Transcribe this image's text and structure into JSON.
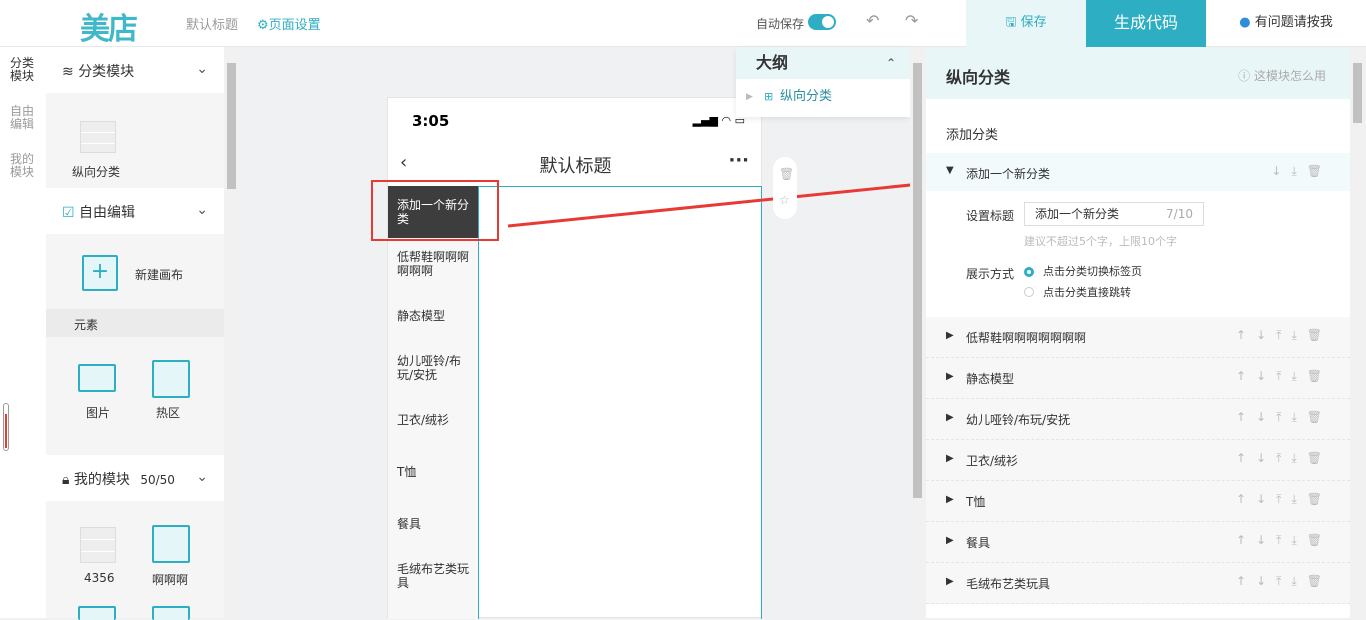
{
  "header": {
    "logo": "美店",
    "title": "默认标题",
    "page_settings": "⚙页面设置",
    "autosave_label": "自动保存",
    "save_label": "保存",
    "generate_label": "生成代码",
    "help_label": "有问题请按我"
  },
  "leftnav": [
    "分类模块",
    "自由编辑",
    "我的模块"
  ],
  "leftpanel": {
    "category_section": "分类模块",
    "vertical_category_tile": "纵向分类",
    "free_edit_section": "自由编辑",
    "new_canvas": "新建画布",
    "elements_label": "元素",
    "image_tile": "图片",
    "hotspot_tile": "热区",
    "my_modules_section": "我的模块",
    "my_modules_count": "50/50",
    "module_a": "4356",
    "module_b": "啊啊啊"
  },
  "phone": {
    "time": "3:05",
    "title": "默认标题",
    "categories": [
      "添加一个新分类",
      "低帮鞋啊啊啊啊啊啊",
      "静态模型",
      "幼儿哑铃/布玩/安抚",
      "卫衣/绒衫",
      "T恤",
      "餐具",
      "毛绒布艺类玩具"
    ]
  },
  "outline": {
    "title": "大纲",
    "item": "纵向分类"
  },
  "rightpanel": {
    "title": "纵向分类",
    "help": "这模块怎么用",
    "add_category": "添加分类",
    "expanded_name": "添加一个新分类",
    "set_title_label": "设置标题",
    "title_input_value": "添加一个新分类",
    "title_count": "7/10",
    "title_hint": "建议不超过5个字，上限10个字",
    "display_mode_label": "展示方式",
    "mode_tab": "点击分类切换标签页",
    "mode_jump": "点击分类直接跳转",
    "rows": [
      "低帮鞋啊啊啊啊啊啊啊",
      "静态模型",
      "幼儿哑铃/布玩/安抚",
      "卫衣/绒衫",
      "T恤",
      "餐具",
      "毛绒布艺类玩具"
    ]
  }
}
